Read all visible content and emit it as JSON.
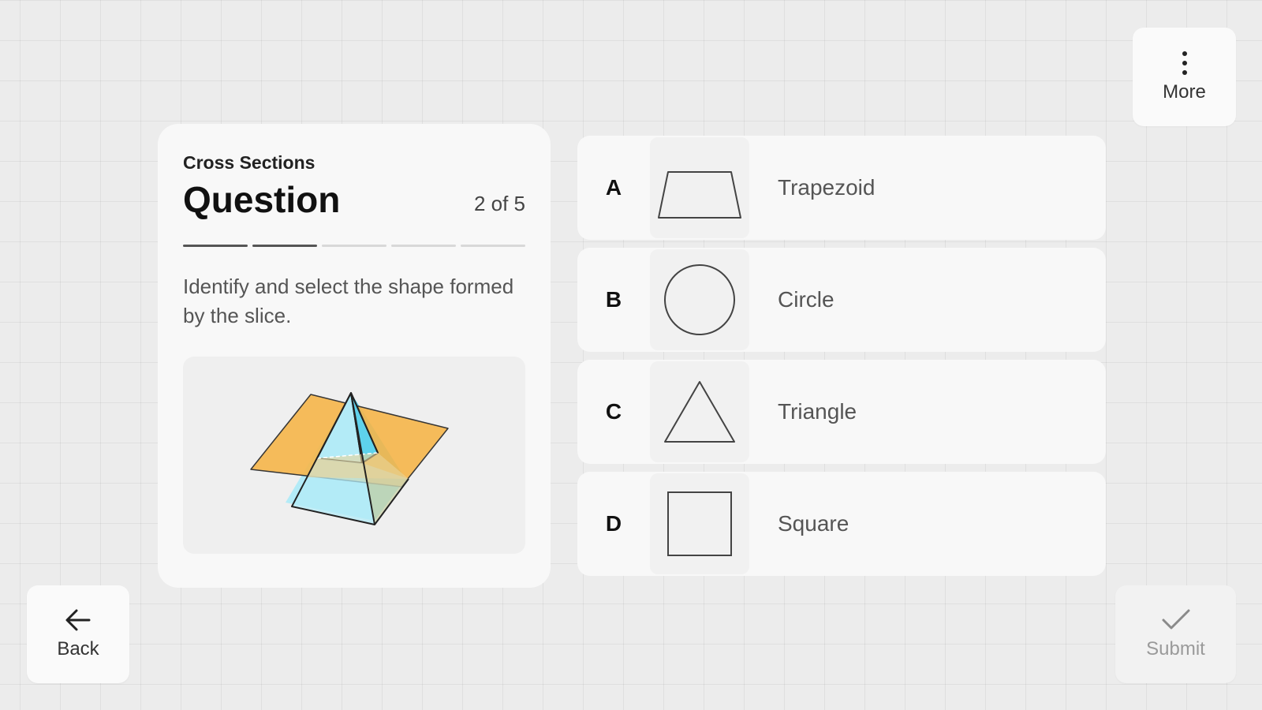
{
  "app": {
    "more_label": "More",
    "back_label": "Back",
    "submit_label": "Submit"
  },
  "question": {
    "topic": "Cross Sections",
    "title": "Question",
    "counter": "2 of 5",
    "current": 2,
    "total": 5,
    "prompt": "Identify and select the shape formed by the slice.",
    "figure_icon": "pyramid-slice-figure"
  },
  "options": [
    {
      "letter": "A",
      "label": "Trapezoid",
      "icon": "trapezoid-icon"
    },
    {
      "letter": "B",
      "label": "Circle",
      "icon": "circle-icon"
    },
    {
      "letter": "C",
      "label": "Triangle",
      "icon": "triangle-icon"
    },
    {
      "letter": "D",
      "label": "Square",
      "icon": "square-icon"
    }
  ],
  "colors": {
    "plane": "#f6b64a",
    "pyramid": "#b3ebf7",
    "pyramid_shade": "#5ed2ec",
    "outline": "#222222"
  }
}
